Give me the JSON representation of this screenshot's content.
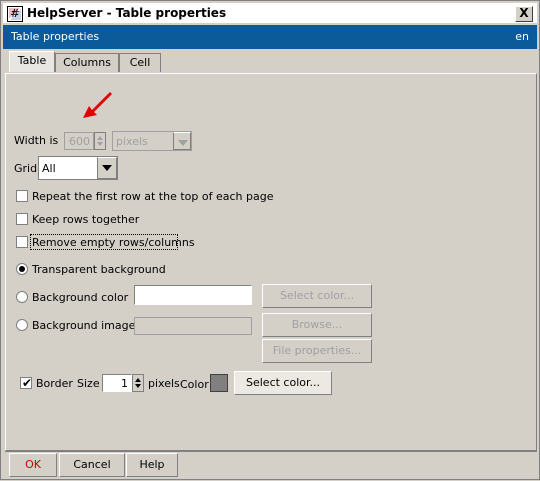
{
  "window": {
    "title": "HelpServer - Table properties",
    "close_label": "X"
  },
  "header": {
    "title": "Table properties",
    "lang": "en"
  },
  "tabs": [
    {
      "label": "Table",
      "active": true
    },
    {
      "label": "Columns",
      "active": false
    },
    {
      "label": "Cell",
      "active": false
    }
  ],
  "form": {
    "width_label": "Width is",
    "width_value": "600",
    "width_unit": "pixels",
    "grid_label": "Grid",
    "grid_value": "All",
    "repeat_first_row_label": "Repeat the first row at the top of each page",
    "keep_rows_together_label": "Keep rows together",
    "remove_empty_label": "Remove empty rows/columns",
    "transparent_bg_label": "Transparent background",
    "bg_color_label": "Background color",
    "bg_image_label": "Background image",
    "select_color_label": "Select color...",
    "browse_label": "Browse...",
    "file_props_label": "File properties...",
    "border_label": "Border",
    "size_label": "Size",
    "size_value": "1",
    "pixels_label": "pixels",
    "color_label": "Color",
    "border_select_color_label": "Select color..."
  },
  "footer": {
    "ok_label": "OK",
    "cancel_label": "Cancel",
    "help_label": "Help"
  },
  "colors": {
    "header_bg": "#0b5a9a",
    "ok_text": "#cc0000",
    "border_swatch": "#808080"
  }
}
